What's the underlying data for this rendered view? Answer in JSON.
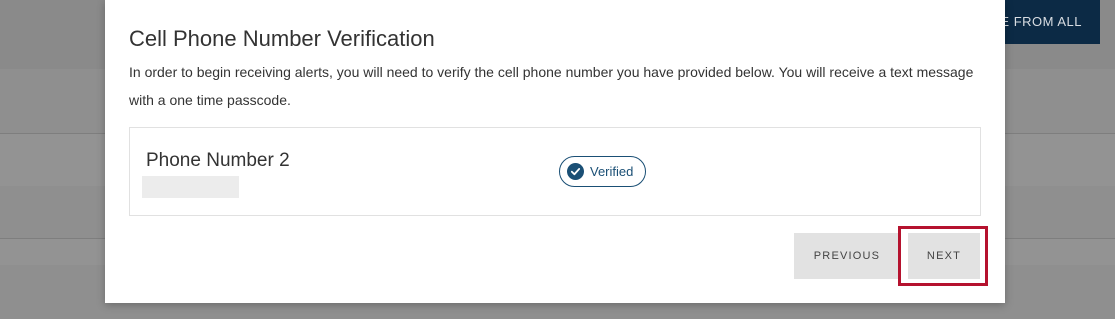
{
  "background": {
    "header_button_label": "E FROM ALL"
  },
  "modal": {
    "title": "Cell Phone Number Verification",
    "description": "In order to begin receiving alerts, you will need to verify the cell phone number you have provided below. You will receive a text message with a one time passcode.",
    "phone": {
      "label": "Phone Number 2",
      "status": "Verified",
      "status_icon": "check-circle-icon"
    },
    "buttons": {
      "previous": "PREVIOUS",
      "next": "NEXT"
    }
  },
  "colors": {
    "accent": "#1a4f75",
    "highlight": "#b5122e",
    "button_bg": "#e2e2e2",
    "header_button_bg": "#0c2a45"
  }
}
